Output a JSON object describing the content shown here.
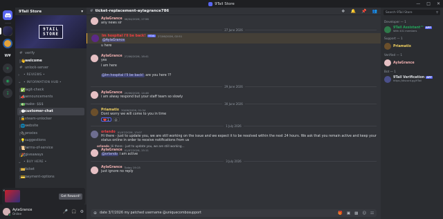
{
  "window": {
    "title": "9Tail Store"
  },
  "rail": {
    "icons": [
      "discord-home",
      "server-1",
      "server-2",
      "server-3",
      "add-server",
      "explore",
      "download"
    ]
  },
  "server": {
    "name": "9Tail Store",
    "banner_line1": "9TAIL",
    "banner_line2": "STORE"
  },
  "channels": [
    {
      "kind": "channel",
      "icon": "#",
      "label": "verify"
    },
    {
      "kind": "channel",
      "icon": "|👋・",
      "label": "welcome",
      "bright": true
    },
    {
      "kind": "channel",
      "icon": "#",
      "label": "unlock-server"
    },
    {
      "kind": "category",
      "icon": "›",
      "label": "• REVIEWS •"
    },
    {
      "kind": "category",
      "icon": "⌄",
      "label": "• INFORMATION HUB •"
    },
    {
      "kind": "channel",
      "icon": "|✅・",
      "label": "legit-check"
    },
    {
      "kind": "channel",
      "icon": "|📣・",
      "label": "announcements"
    },
    {
      "kind": "channel",
      "icon": "|💵・",
      "label": "make- $$$"
    },
    {
      "kind": "channel",
      "icon": "|💬・",
      "label": "customer-chat",
      "bright": true,
      "active": true
    },
    {
      "kind": "channel",
      "icon": "|🔓",
      "label": "steam-unlocker"
    },
    {
      "kind": "channel",
      "icon": "|🌐・",
      "label": "website"
    },
    {
      "kind": "channel",
      "icon": "|🔌・",
      "label": "proxies"
    },
    {
      "kind": "channel",
      "icon": "|💡・",
      "label": "suggestions"
    },
    {
      "kind": "channel",
      "icon": "|📜・",
      "label": "terms-of-service"
    },
    {
      "kind": "channel",
      "icon": "|🎉・",
      "label": "giveaways"
    },
    {
      "kind": "category",
      "icon": "⌄",
      "label": "• BUY HERE •"
    },
    {
      "kind": "channel",
      "icon": "|🎫・",
      "label": "ticket"
    },
    {
      "kind": "channel",
      "icon": "|💳・",
      "label": "payment-options"
    }
  ],
  "promo": {
    "button": "Get Reward!"
  },
  "user": {
    "name": "AylaGrance",
    "status": "Online"
  },
  "chat": {
    "channel": "ticket-replacement-aylagrance786",
    "composer_text": "date 3/7/2026 my patched username @uniquecombosupport",
    "messages": [
      {
        "type": "msg",
        "av": "ayla",
        "name": "AylaGrance",
        "time": "06/04/2026, 17:56",
        "text": "any news sir",
        "continuation": true
      },
      {
        "type": "date",
        "label": "27 June 2026"
      },
      {
        "type": "msg",
        "av": "hosp",
        "name": "Im hospital I'll be back!",
        "nameColor": "red",
        "tag": "9TAIL",
        "time": "27/06/2026, 02:51",
        "text": "@AylaGrance",
        "mention": true,
        "highlight": true
      },
      {
        "type": "line",
        "text": "u here"
      },
      {
        "type": "msg",
        "av": "ayla",
        "name": "AylaGrance",
        "time": "27/06/2026, 18:41",
        "text": "yes"
      },
      {
        "type": "line",
        "text": "i am here"
      },
      {
        "type": "line",
        "text": "are you here ??",
        "prefix_mention": "@Im hospital I'll be back!"
      },
      {
        "type": "date",
        "label": "29 June 2026"
      },
      {
        "type": "msg",
        "av": "ayla",
        "name": "AylaGrance",
        "time": "29/06/2026, 14:46",
        "text": "i am alway respond but your staff team so slowly"
      },
      {
        "type": "date",
        "label": "30 June 2026"
      },
      {
        "type": "msg",
        "av": "pri",
        "name": "Priamatix",
        "nameColor": "gold",
        "time": "30/06/2026, 01:54",
        "text": "Dont worry we will come to you in time",
        "reactions": [
          {
            "emoji": "❤️",
            "count": "1"
          }
        ]
      },
      {
        "type": "date",
        "label": "1 July 2026"
      },
      {
        "type": "msg",
        "av": "orl",
        "name": "orlando",
        "nameColor": "red",
        "time": "01/07/2026, 13:07",
        "text": "Hi there - just to update you, we are still working on the issue and we expect it to be resolved within the next 24 hours. We ask that you remain active and keep your status online in order to receive notifications from us"
      },
      {
        "type": "reply",
        "to": "orlando",
        "text": "Hi there - just to update you, we are still working..."
      },
      {
        "type": "msg",
        "av": "ayla",
        "name": "AylaGrance",
        "time": "01/07/2026, 15:11",
        "text": "i am active",
        "prefix_mention": "@orlando"
      },
      {
        "type": "date",
        "label": "3 July 2026"
      },
      {
        "type": "msg",
        "av": "ayla",
        "name": "AylaGrance",
        "time": "Today 19:15",
        "text": "just ignore no reply"
      }
    ]
  },
  "members": {
    "search_placeholder": "Search 9Tail Store",
    "groups": [
      {
        "title": "Developer — 1",
        "items": [
          {
            "name": "9Tail Assistant™",
            "app": "APP",
            "sub": "With 401 members",
            "color": "#23a55a",
            "av": "#2f7a4a"
          }
        ]
      },
      {
        "title": "Support — 1",
        "items": [
          {
            "name": "Priamatix",
            "sub": "",
            "color": "#f0d060",
            "av": "#6b4f2b"
          }
        ]
      },
      {
        "title": "Verified — 1",
        "items": [
          {
            "name": "AylaGrance",
            "sub": "",
            "color": "#f0b0b0",
            "av": "#e6c0c4"
          }
        ]
      },
      {
        "title": "Bot — 1",
        "items": [
          {
            "name": "9Tail Verification",
            "app": "APP",
            "sub": "https://discord.gg/9Tail",
            "color": "#dbdee1",
            "av": "#4a4f8a"
          }
        ]
      }
    ]
  },
  "colors": {
    "accent": "#5865f2",
    "online": "#23a55a",
    "danger": "#f23f43"
  }
}
